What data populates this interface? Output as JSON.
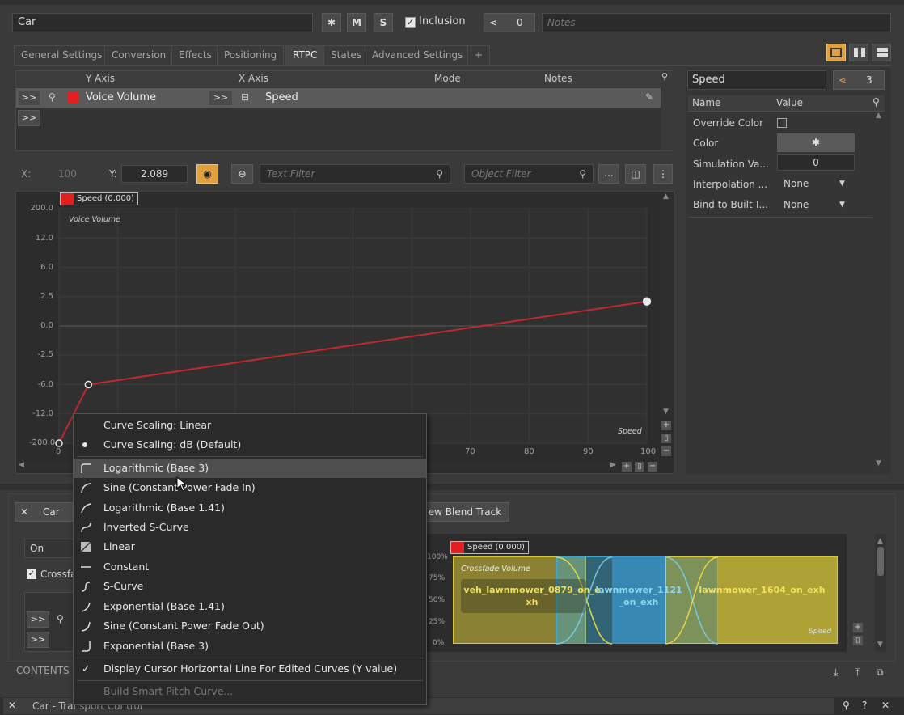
{
  "top_bar": {
    "object_name": "Car",
    "m_label": "M",
    "s_label": "S",
    "inclusion_label": "Inclusion",
    "share_count": "0",
    "notes_placeholder": "Notes"
  },
  "tabs": [
    {
      "label": "General Settings"
    },
    {
      "label": "Conversion"
    },
    {
      "label": "Effects"
    },
    {
      "label": "Positioning"
    },
    {
      "label": "RTPC"
    },
    {
      "label": "States"
    },
    {
      "label": "Advanced Settings"
    },
    {
      "label": "+"
    }
  ],
  "rtpc_table": {
    "headers": {
      "y_axis": "Y Axis",
      "x_axis": "X Axis",
      "mode": "Mode",
      "notes": "Notes"
    },
    "row": {
      "expand": ">>",
      "y_axis": "Voice Volume",
      "x_expand": ">>",
      "x_axis": "Speed"
    },
    "empty_expand": ">>"
  },
  "curve_toolbar": {
    "x_label": "X:",
    "x_value": "100",
    "y_label": "Y:",
    "y_value": "2.089",
    "text_filter_placeholder": "Text Filter",
    "object_filter_placeholder": "Object Filter",
    "more_label": "..."
  },
  "graph": {
    "tag": "Speed (0.000)",
    "y_axis_name": "Voice Volume",
    "x_axis_name": "Speed",
    "y_ticks": [
      "200.0",
      "12.0",
      "6.0",
      "2.5",
      "0.0",
      "-2.5",
      "-6.0",
      "-12.0",
      "-200.0"
    ],
    "x_ticks": [
      "0",
      "70",
      "80",
      "90",
      "100"
    ],
    "curve_color": "#c0282d"
  },
  "chart_data": {
    "type": "line",
    "xlabel": "Speed",
    "ylabel": "Voice Volume",
    "series": [
      {
        "name": "Speed (0.000)",
        "x": [
          0,
          5,
          100
        ],
        "y": [
          -200,
          -6,
          2.089
        ]
      }
    ],
    "xlim": [
      0,
      100
    ]
  },
  "properties": {
    "search_value": "Speed",
    "share_count": "3",
    "headers": {
      "name": "Name",
      "value": "Value"
    },
    "rows": [
      {
        "name": "Override Color",
        "value": ""
      },
      {
        "name": "Color",
        "value": ""
      },
      {
        "name": "Simulation Va...",
        "value": "0"
      },
      {
        "name": "Interpolation ...",
        "value": "None"
      },
      {
        "name": "Bind to Built-I...",
        "value": "None"
      }
    ]
  },
  "context_menu": {
    "items": [
      {
        "label": "Curve Scaling: Linear",
        "icon": "none"
      },
      {
        "label": "Curve Scaling: dB (Default)",
        "icon": "bullet-icon"
      },
      {
        "label": "Logarithmic (Base 3)",
        "icon": "log3-curve-icon"
      },
      {
        "label": "Sine (Constant Power Fade In)",
        "icon": "sine-in-curve-icon"
      },
      {
        "label": "Logarithmic (Base 1.41)",
        "icon": "log141-curve-icon"
      },
      {
        "label": "Inverted S-Curve",
        "icon": "inverted-s-curve-icon"
      },
      {
        "label": "Linear",
        "icon": "linear-curve-icon"
      },
      {
        "label": "Constant",
        "icon": "constant-curve-icon"
      },
      {
        "label": "S-Curve",
        "icon": "s-curve-icon"
      },
      {
        "label": "Exponential (Base 1.41)",
        "icon": "exp141-curve-icon"
      },
      {
        "label": "Sine (Constant Power Fade Out)",
        "icon": "sine-out-curve-icon"
      },
      {
        "label": "Exponential (Base 3)",
        "icon": "exp3-curve-icon"
      },
      {
        "label": "Display Cursor Horizontal Line For Edited Curves (Y value)",
        "icon": "checkmark-icon"
      },
      {
        "label": "Build Smart Pitch Curve...",
        "icon": "none"
      }
    ]
  },
  "blend": {
    "header_name": "Car",
    "new_blend_label": "ew Blend Track",
    "on_value": "On",
    "crossfade_label": "Crossfa",
    "expand1": ">>",
    "expand2": ">>",
    "tag": "Speed (0.000)",
    "crossfade_volume": "Crossfade Volume",
    "y_ticks": [
      "100%",
      "75%",
      "50%",
      "25%",
      "0%"
    ],
    "x_axis_name": "Speed",
    "tracks": [
      {
        "name": "veh_lawnmower_0879_on_exh"
      },
      {
        "name": "lawnmower_1121_on_exh"
      },
      {
        "name": "lawnmower_1604_on_exh"
      }
    ]
  },
  "footer": {
    "contents_label": "CONTENTS",
    "transport_title": "Car - Transport Control"
  },
  "colors": {
    "accent_orange": "#e0a040",
    "curve_red": "#c0282d",
    "yellow_track": "#d9c83a",
    "blue_track": "#3aa8d0"
  }
}
